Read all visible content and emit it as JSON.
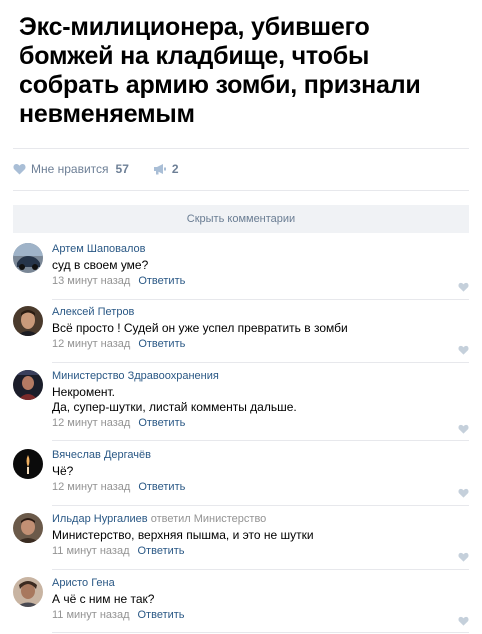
{
  "post": {
    "title": "Экс-милиционера, убившего бомжей на кладбище, чтобы собрать армию зомби, признали невменяемым"
  },
  "actions": {
    "like_label": "Мне нравится",
    "like_count": "57",
    "share_count": "2"
  },
  "hide_comments_label": "Скрыть комментарии",
  "comments": [
    {
      "author": "Артем Шаповалов",
      "reply_to": "",
      "lines": [
        "суд в своем уме?"
      ],
      "time": "13 минут назад",
      "reply": "Ответить"
    },
    {
      "author": "Алексей Петров",
      "reply_to": "",
      "lines": [
        "Всё просто ! Судей он уже успел превратить в зомби"
      ],
      "time": "12 минут назад",
      "reply": "Ответить"
    },
    {
      "author": "Министерство Здравоохранения",
      "reply_to": "",
      "lines": [
        "Некромент.",
        "Да, супер-шутки, листай комменты дальше."
      ],
      "time": "12 минут назад",
      "reply": "Ответить"
    },
    {
      "author": "Вячеслав Дергачёв",
      "reply_to": "",
      "lines": [
        "Чё?"
      ],
      "time": "12 минут назад",
      "reply": "Ответить"
    },
    {
      "author": "Ильдар Нургалиев",
      "reply_to": "ответил Министерство",
      "lines": [
        "Министерство, верхняя пышма, и это не шутки"
      ],
      "time": "11 минут назад",
      "reply": "Ответить"
    },
    {
      "author": "Аристо Гена",
      "reply_to": "",
      "lines": [
        "А чё с ним не так?"
      ],
      "time": "11 минут назад",
      "reply": "Ответить"
    }
  ],
  "colors": {
    "link": "#2a5885",
    "meta": "#939393",
    "action": "#6d7f96",
    "bar_bg": "#f0f2f5"
  }
}
